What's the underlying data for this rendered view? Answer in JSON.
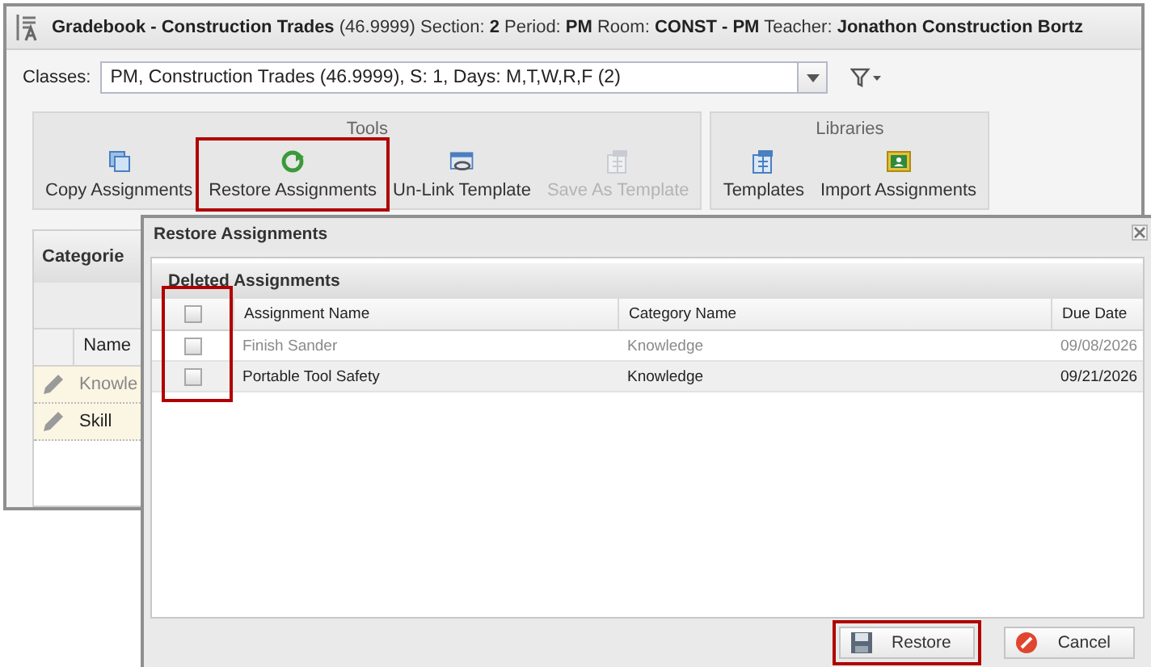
{
  "window": {
    "title": "**Gradebook - Construction Trades** (46.9999) Section: **2** Period: **PM** Room: **CONST - PM** Teacher: **Jonathon Construction Bortz**"
  },
  "classes": {
    "label": "Classes:",
    "value": "PM, Construction Trades (46.9999), S: 1, Days: M,T,W,R,F (2)"
  },
  "toolbar_groups": [
    {
      "title": "Tools",
      "buttons": [
        {
          "label": "Copy Assignments",
          "kind": "copy",
          "disabled": false,
          "highlighted": false
        },
        {
          "label": "Restore Assignments",
          "kind": "restore",
          "disabled": false,
          "highlighted": true
        },
        {
          "label": "Un-Link Template",
          "kind": "unlink",
          "disabled": false,
          "highlighted": false
        },
        {
          "label": "Save As Template",
          "kind": "template",
          "disabled": true,
          "highlighted": false
        }
      ]
    },
    {
      "title": "Libraries",
      "buttons": [
        {
          "label": "Templates",
          "kind": "template",
          "disabled": false,
          "highlighted": false
        },
        {
          "label": "Import Assignments",
          "kind": "import",
          "disabled": false,
          "highlighted": false
        }
      ]
    }
  ],
  "categories": {
    "title": "Categorie",
    "columns": [
      "Name"
    ],
    "rows": [
      {
        "name": "Knowle",
        "muted": true
      },
      {
        "name": "Skill",
        "muted": false
      }
    ]
  },
  "dialog": {
    "title": "Restore Assignments",
    "section": "Deleted Assignments",
    "checkbox_column_highlighted": true,
    "columns": [
      "Assignment Name",
      "Category Name",
      "Due Date"
    ],
    "rows": [
      {
        "checked": false,
        "muted": true,
        "hovered": false,
        "cells": [
          "Finish Sander",
          "Knowledge",
          "09/08/2026"
        ]
      },
      {
        "checked": false,
        "muted": false,
        "hovered": true,
        "cells": [
          "Portable Tool Safety",
          "Knowledge",
          "09/21/2026"
        ]
      }
    ],
    "header_checked": false,
    "buttons": [
      {
        "label": "Restore",
        "kind": "save",
        "highlighted": true
      },
      {
        "label": "Cancel",
        "kind": "cancel",
        "highlighted": false
      }
    ]
  }
}
